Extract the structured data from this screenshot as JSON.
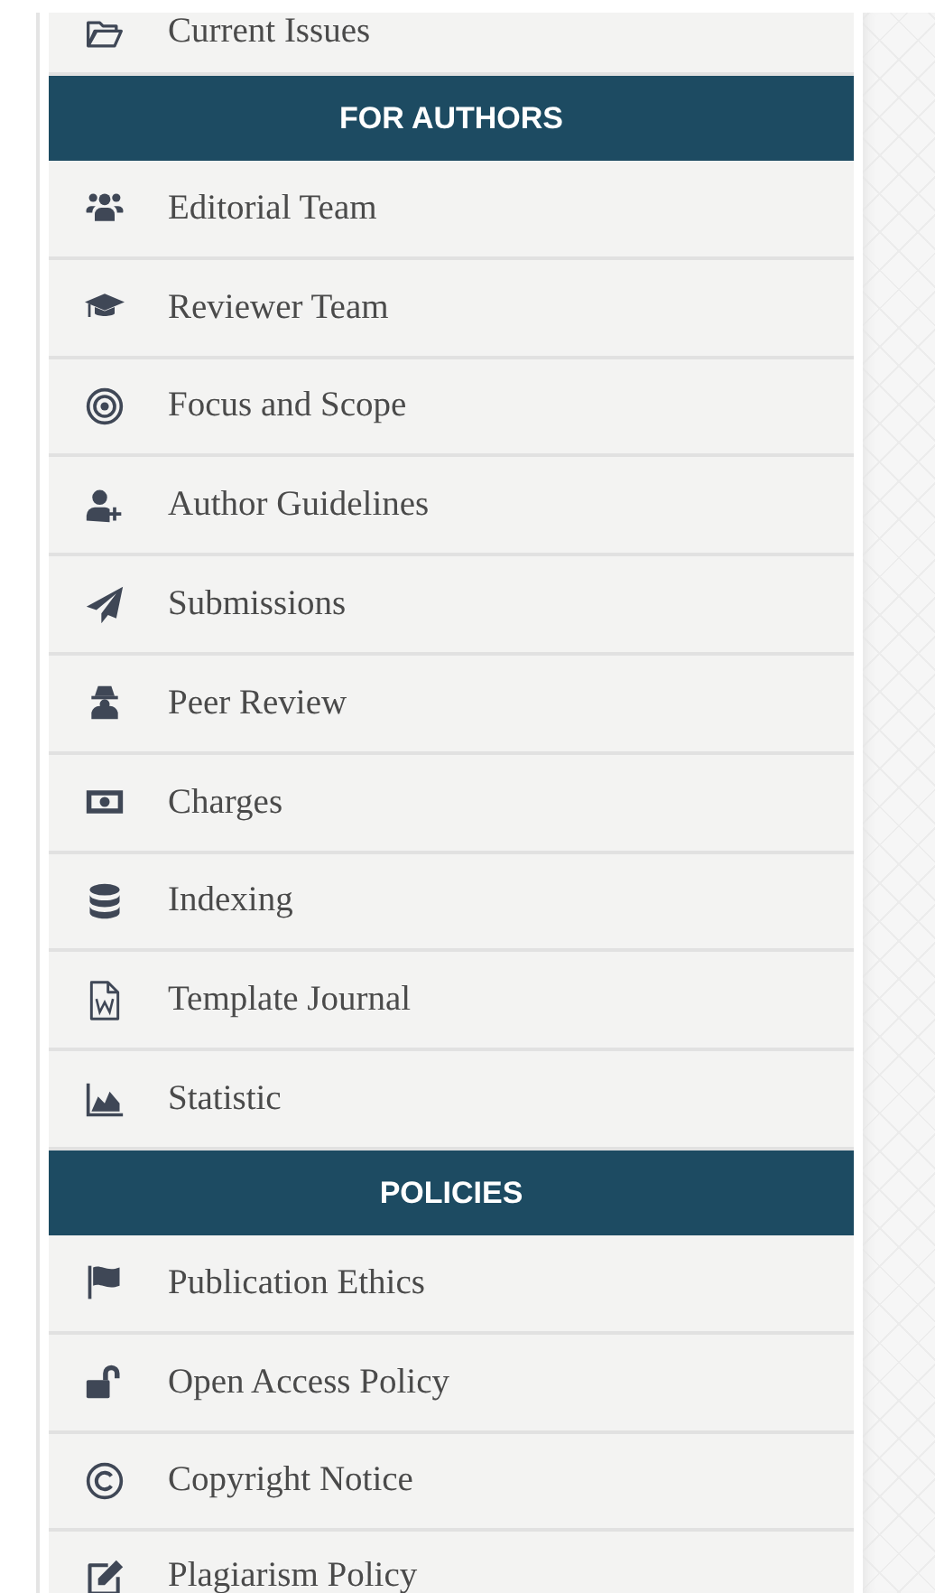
{
  "menu": [
    {
      "kind": "link",
      "label": "Current Issues"
    },
    {
      "kind": "header",
      "label": "FOR AUTHORS"
    },
    {
      "kind": "link",
      "label": "Editorial Team"
    },
    {
      "kind": "link",
      "label": "Reviewer Team"
    },
    {
      "kind": "link",
      "label": "Focus and Scope"
    },
    {
      "kind": "link",
      "label": "Author Guidelines"
    },
    {
      "kind": "link",
      "label": "Submissions"
    },
    {
      "kind": "link",
      "label": "Peer Review"
    },
    {
      "kind": "link",
      "label": "Charges"
    },
    {
      "kind": "link",
      "label": "Indexing"
    },
    {
      "kind": "link",
      "label": "Template Journal"
    },
    {
      "kind": "link",
      "label": "Statistic"
    },
    {
      "kind": "header",
      "label": "POLICIES"
    },
    {
      "kind": "link",
      "label": "Publication Ethics"
    },
    {
      "kind": "link",
      "label": "Open Access Policy"
    },
    {
      "kind": "link",
      "label": "Copyright Notice"
    },
    {
      "kind": "link",
      "label": "Plagiarism Policy"
    }
  ]
}
